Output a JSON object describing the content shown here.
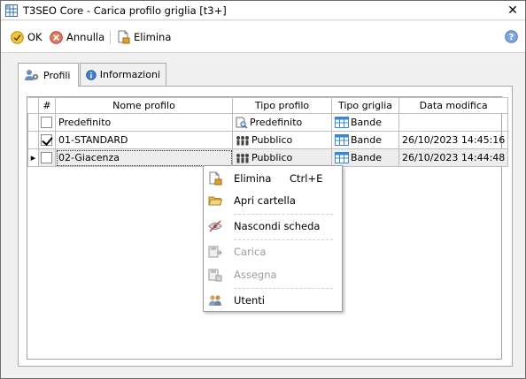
{
  "window": {
    "title": "T3SEO Core - Carica profilo griglia [t3+]",
    "close_symbol": "✕"
  },
  "toolbar": {
    "ok_label": "OK",
    "cancel_label": "Annulla",
    "delete_label": "Elimina",
    "help_symbol": "?"
  },
  "tabs": [
    {
      "label": "Profili",
      "active": true
    },
    {
      "label": "Informazioni",
      "active": false
    }
  ],
  "grid": {
    "columns": [
      "#",
      "Nome profilo",
      "Tipo profilo",
      "Tipo griglia",
      "Data modifica"
    ],
    "rows": [
      {
        "indicator": "",
        "checked": false,
        "name": "Predefinito",
        "profile_type": "Predefinito",
        "profile_type_icon": "document-search-icon",
        "grid_type": "Bande",
        "modified": ""
      },
      {
        "indicator": "",
        "checked": true,
        "name": "01-STANDARD",
        "profile_type": "Pubblico",
        "profile_type_icon": "people-group-icon",
        "grid_type": "Bande",
        "modified": "26/10/2023 14:45:16"
      },
      {
        "indicator": "▸",
        "checked": false,
        "name": "02-Giacenza",
        "profile_type": "Pubblico",
        "profile_type_icon": "people-group-icon",
        "grid_type": "Bande",
        "modified": "26/10/2023 14:44:48"
      }
    ]
  },
  "context_menu": {
    "items": [
      {
        "label": "Elimina",
        "shortcut": "Ctrl+E",
        "icon": "delete-document-icon",
        "disabled": false
      },
      {
        "label": "Apri cartella",
        "shortcut": "",
        "icon": "folder-icon",
        "disabled": false
      },
      {
        "label": "Nascondi scheda",
        "shortcut": "",
        "icon": "hide-eye-icon",
        "disabled": false
      },
      {
        "label": "Carica",
        "shortcut": "",
        "icon": "load-icon",
        "disabled": true
      },
      {
        "label": "Assegna",
        "shortcut": "",
        "icon": "assign-icon",
        "disabled": true
      },
      {
        "label": "Utenti",
        "shortcut": "",
        "icon": "users-icon",
        "disabled": false
      }
    ]
  },
  "colors": {
    "accent_blue": "#1c6fd1",
    "ok_yellow": "#e8b923",
    "cancel_red": "#d9534f"
  }
}
